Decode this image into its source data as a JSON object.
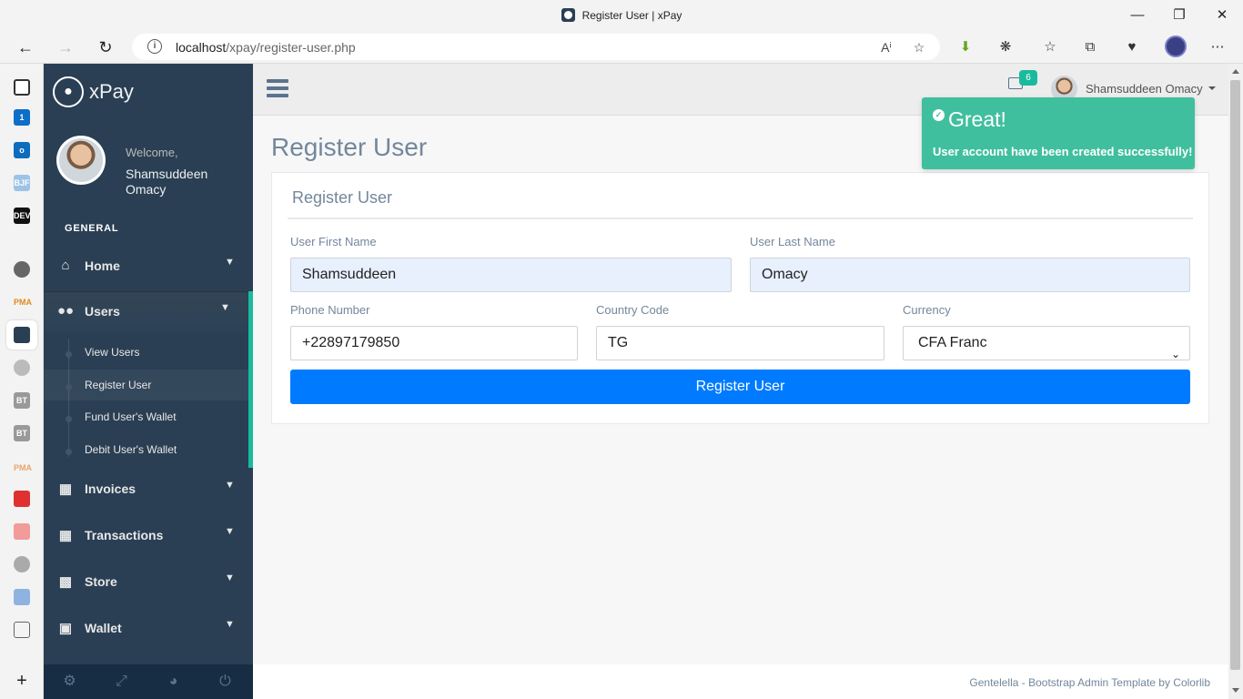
{
  "browser": {
    "tab_title": "Register User | xPay",
    "url_host": "localhost",
    "url_path": "/xpay/register-user.php"
  },
  "edge_sidebar": {
    "icons": [
      "tab-actions-icon",
      "badge-1-icon",
      "outlook-icon",
      "bjf-icon",
      "dev-icon",
      "github-icon",
      "pma-icon",
      "xpay-icon",
      "anchor-icon",
      "bt-icon",
      "bt-icon",
      "pma-icon",
      "red-box-icon",
      "red-stack-icon",
      "search-icon",
      "cube-icon",
      "file-icon",
      "file-icon",
      "add-icon"
    ],
    "labels": {
      "one": "1",
      "bjf": "BJF",
      "dev": "DEV",
      "bt": "BT",
      "pma": "PMA"
    }
  },
  "app": {
    "brand": "xPay",
    "welcome": "Welcome,",
    "profile_name": "Shamsuddeen Omacy",
    "section": "GENERAL",
    "menu": {
      "home": "Home",
      "users": "Users",
      "invoices": "Invoices",
      "transactions": "Transactions",
      "store": "Store",
      "wallet": "Wallet"
    },
    "submenu": {
      "view_users": "View Users",
      "register_user": "Register User",
      "fund_wallet": "Fund User's Wallet",
      "debit_wallet": "Debit User's Wallet"
    }
  },
  "topnav": {
    "mail_count": "6",
    "user_name": "Shamsuddeen Omacy"
  },
  "page": {
    "title": "Register User",
    "panel_title": "Register User"
  },
  "form": {
    "first_name_label": "User First Name",
    "first_name_value": "Shamsuddeen",
    "last_name_label": "User Last Name",
    "last_name_value": "Omacy",
    "phone_label": "Phone Number",
    "phone_value": "+22897179850",
    "country_label": "Country Code",
    "country_value": "TG",
    "currency_label": "Currency",
    "currency_value": "CFA Franc",
    "submit_label": "Register User"
  },
  "notification": {
    "title": "Great!",
    "message": "User account have been created successfully!"
  },
  "footer": {
    "text": "Gentelella - Bootstrap Admin Template by Colorlib"
  },
  "colors": {
    "sidebar": "#2a3f54",
    "accent": "#1abb9c",
    "primary": "#007bff",
    "notify": "#40bf9e"
  }
}
